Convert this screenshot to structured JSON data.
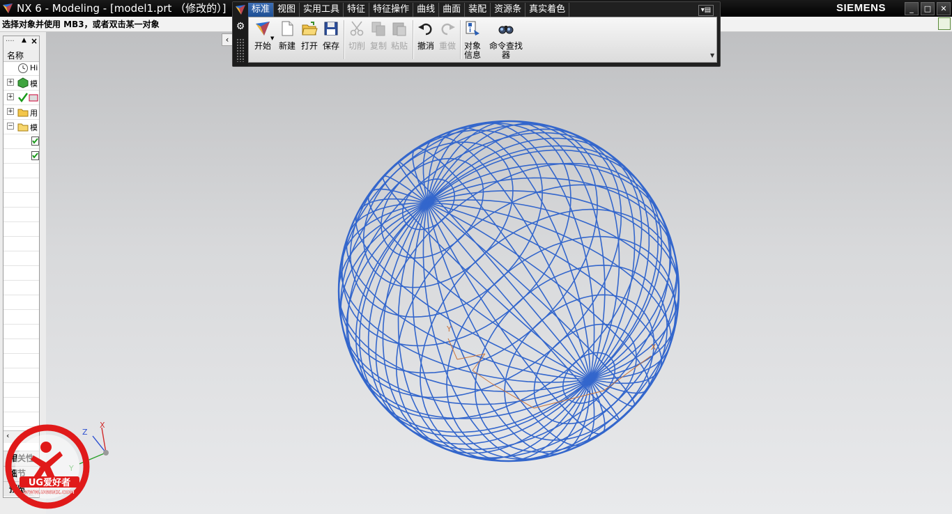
{
  "window": {
    "title": "NX 6 - Modeling - [model1.prt （修改的）]",
    "brand": "SIEMENS",
    "controls": [
      "_",
      "□",
      "✕"
    ]
  },
  "status": {
    "prompt": "选择对象并使用 MB3，或者双击某一对象"
  },
  "ribbon": {
    "tabs": [
      {
        "label": "标准",
        "active": true
      },
      {
        "label": "视图"
      },
      {
        "label": "实用工具"
      },
      {
        "label": "特征"
      },
      {
        "label": "特征操作"
      },
      {
        "label": "曲线"
      },
      {
        "label": "曲面"
      },
      {
        "label": "装配"
      },
      {
        "label": "资源条"
      },
      {
        "label": "真实着色"
      }
    ],
    "tools": {
      "start": "开始",
      "new": "新建",
      "open": "打开",
      "save": "保存",
      "cut": "切削",
      "copy": "复制",
      "paste": "粘贴",
      "undo": "撤消",
      "redo": "重做",
      "info_line1": "对象",
      "info_line2": "信息",
      "finder_line1": "命令查找",
      "finder_line2": "器"
    }
  },
  "navigator": {
    "column_name": "名称",
    "rows": [
      {
        "icon": "history-clock-icon",
        "text": "Hi"
      },
      {
        "icon": "model-views-icon",
        "text": "模"
      },
      {
        "icon": "camera-icon",
        "text": ""
      },
      {
        "icon": "user-expressions-folder-icon",
        "text": "用"
      },
      {
        "icon": "model-history-folder-icon",
        "text": "模"
      }
    ],
    "panels": {
      "dependencies": "相关性",
      "details": "细节",
      "preview": "预览"
    }
  },
  "viewport": {
    "wire_color": "#3366cc",
    "background_top": "#bfc0c2",
    "background_bottom": "#e9eaec",
    "triad": {
      "x": "X",
      "y": "Y",
      "z": "Z"
    },
    "csys_small": {
      "x": "X",
      "y": "Y"
    }
  },
  "watermark": {
    "logo_text": "UG爱好者",
    "url": "WWW.UGSNX.COM"
  }
}
